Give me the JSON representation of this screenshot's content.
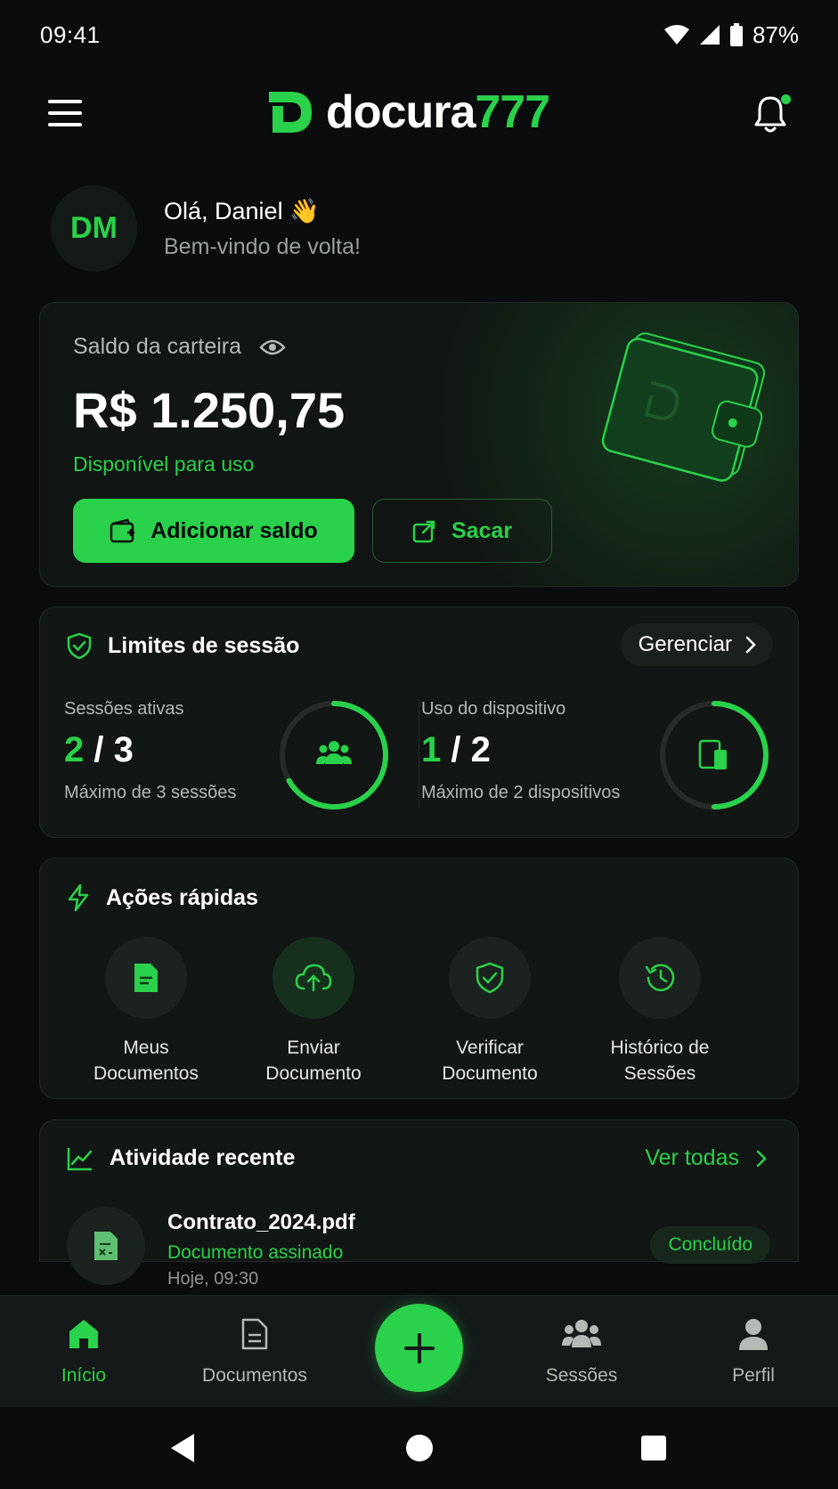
{
  "status": {
    "time": "09:41",
    "battery": "87%"
  },
  "header": {
    "logo_main": "docura",
    "logo_accent": "777"
  },
  "greeting": {
    "initials": "DM",
    "title": "Olá, Daniel 👋",
    "subtitle": "Bem-vindo de volta!"
  },
  "wallet": {
    "label": "Saldo da carteira",
    "amount": "R$ 1.250,75",
    "available": "Disponível para uso",
    "add_label": "Adicionar saldo",
    "withdraw_label": "Sacar"
  },
  "sessions": {
    "title": "Limites de sessão",
    "manage_label": "Gerenciar",
    "active": {
      "label": "Sessões ativas",
      "current": "2",
      "max": " / 3",
      "note": "Máximo de 3 sessões",
      "progress": 0.667
    },
    "devices": {
      "label": "Uso do dispositivo",
      "current": "1",
      "max": " / 2",
      "note": "Máximo de 2 dispositivos",
      "progress": 0.5
    }
  },
  "actions": {
    "title": "Ações rápidas",
    "items": [
      {
        "line1": "Meus",
        "line2": "Documentos",
        "icon": "document-icon"
      },
      {
        "line1": "Enviar",
        "line2": "Documento",
        "icon": "cloud-upload-icon"
      },
      {
        "line1": "Verificar",
        "line2": "Documento",
        "icon": "shield-check-icon"
      },
      {
        "line1": "Histórico de",
        "line2": "Sessões",
        "icon": "history-icon"
      }
    ]
  },
  "activity": {
    "title": "Atividade recente",
    "see_all": "Ver todas",
    "items": [
      {
        "name": "Contrato_2024.pdf",
        "status": "Documento assinado",
        "time": "Hoje, 09:30",
        "badge": "Concluído"
      }
    ]
  },
  "nav": {
    "items": [
      {
        "label": "Início",
        "icon": "home-icon"
      },
      {
        "label": "Documentos",
        "icon": "document-icon"
      },
      {
        "label": "Sessões",
        "icon": "users-icon"
      },
      {
        "label": "Perfil",
        "icon": "user-icon"
      }
    ]
  },
  "colors": {
    "accent": "#2ad14a",
    "background": "#0a0c0d",
    "card": "#121614"
  }
}
